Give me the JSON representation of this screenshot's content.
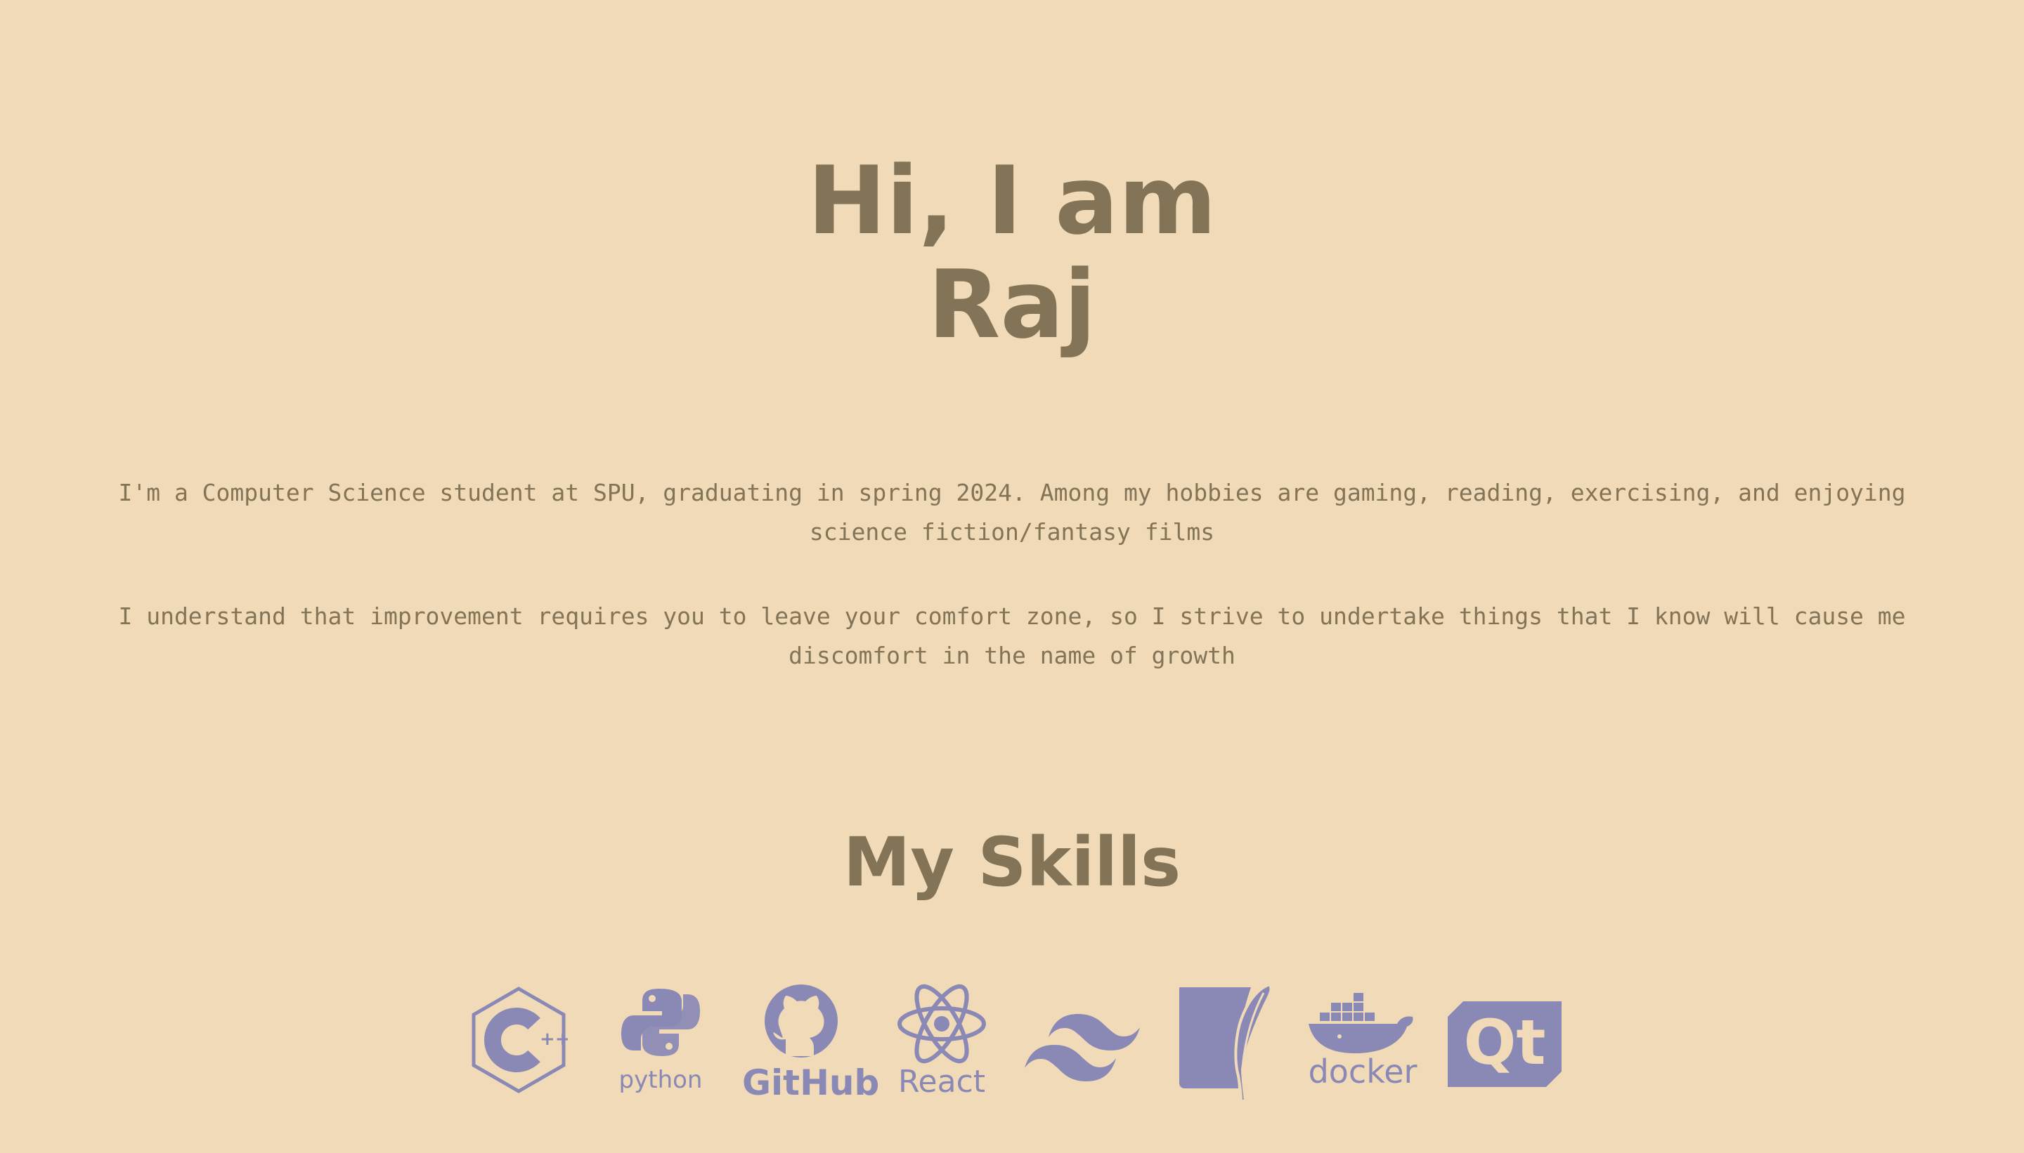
{
  "hero": {
    "line1": "Hi, I am",
    "line2": "Raj"
  },
  "bio": {
    "paragraph1": "I'm a Computer Science student at SPU, graduating in spring 2024. Among my hobbies are gaming, reading, exercising, and enjoying science fiction/fantasy films",
    "paragraph2": "I understand that improvement requires you to leave your comfort zone, so I strive to undertake things that I know will cause me discomfort in the name of growth"
  },
  "skills": {
    "title": "My Skills",
    "icons": [
      {
        "name": "cplusplus-icon",
        "label": ""
      },
      {
        "name": "python-icon",
        "label": "python"
      },
      {
        "name": "github-icon",
        "label": "GitHub"
      },
      {
        "name": "react-icon",
        "label": "React"
      },
      {
        "name": "tailwind-icon",
        "label": ""
      },
      {
        "name": "sqlite-icon",
        "label": ""
      },
      {
        "name": "docker-icon",
        "label": "docker"
      },
      {
        "name": "qt-icon",
        "label": "Qt"
      }
    ]
  },
  "colors": {
    "background": "#f0dab7",
    "text": "#837458",
    "icon": "#8a89b6"
  }
}
